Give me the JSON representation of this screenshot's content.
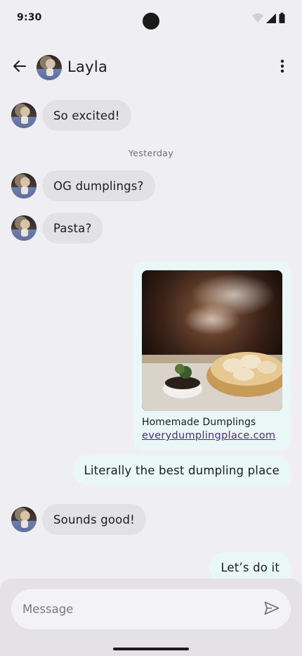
{
  "status_bar": {
    "time": "9:30"
  },
  "header": {
    "contact_name": "Layla"
  },
  "messages": [
    {
      "text": "So excited!"
    },
    {
      "text": "OG dumplings?"
    },
    {
      "text": "Pasta?"
    },
    {
      "text": "Literally the best dumpling place"
    },
    {
      "text": "Sounds good!"
    },
    {
      "text": "Let’s do it"
    }
  ],
  "divider": {
    "label": "Yesterday"
  },
  "link_card": {
    "title": "Homemade Dumplings",
    "url": "everydumplingplace.com"
  },
  "composer": {
    "placeholder": "Message"
  },
  "icons": {
    "back": "arrow-back-icon",
    "more": "more-vert-icon",
    "send": "send-icon",
    "wifi": "wifi-icon",
    "signal": "signal-icon",
    "battery": "battery-icon"
  },
  "colors": {
    "background": "#efeef2",
    "incoming_bubble": "#e2e1e6",
    "outgoing_bubble": "#e9f7f6",
    "link": "#4b2a8a"
  }
}
